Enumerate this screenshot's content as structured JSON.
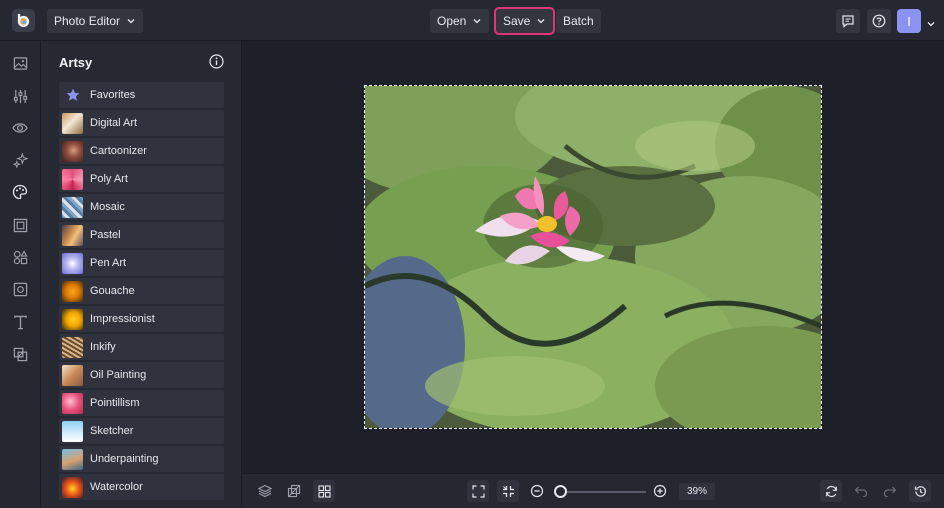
{
  "topbar": {
    "app_menu_label": "Photo Editor",
    "open_label": "Open",
    "save_label": "Save",
    "batch_label": "Batch",
    "avatar_initial": "I",
    "highlight_color": "#e0357a"
  },
  "left_rail": {
    "icons": [
      "image-icon",
      "sliders-icon",
      "eye-icon",
      "sparkle-icon",
      "palette-icon",
      "frame-icon",
      "shapes-icon",
      "graphics-icon",
      "text-icon",
      "overlay-icon"
    ]
  },
  "panel": {
    "title": "Artsy",
    "items": [
      {
        "label": "Favorites",
        "icon": "star-icon"
      },
      {
        "label": "Digital Art"
      },
      {
        "label": "Cartoonizer"
      },
      {
        "label": "Poly Art"
      },
      {
        "label": "Mosaic"
      },
      {
        "label": "Pastel"
      },
      {
        "label": "Pen Art"
      },
      {
        "label": "Gouache"
      },
      {
        "label": "Impressionist"
      },
      {
        "label": "Inkify"
      },
      {
        "label": "Oil Painting"
      },
      {
        "label": "Pointillism"
      },
      {
        "label": "Sketcher"
      },
      {
        "label": "Underpainting"
      },
      {
        "label": "Watercolor"
      }
    ]
  },
  "canvas": {
    "image_subject": "painted water lily on lily pads"
  },
  "bottombar": {
    "zoom_percent": "39%",
    "zoom_fraction": 0.05
  }
}
